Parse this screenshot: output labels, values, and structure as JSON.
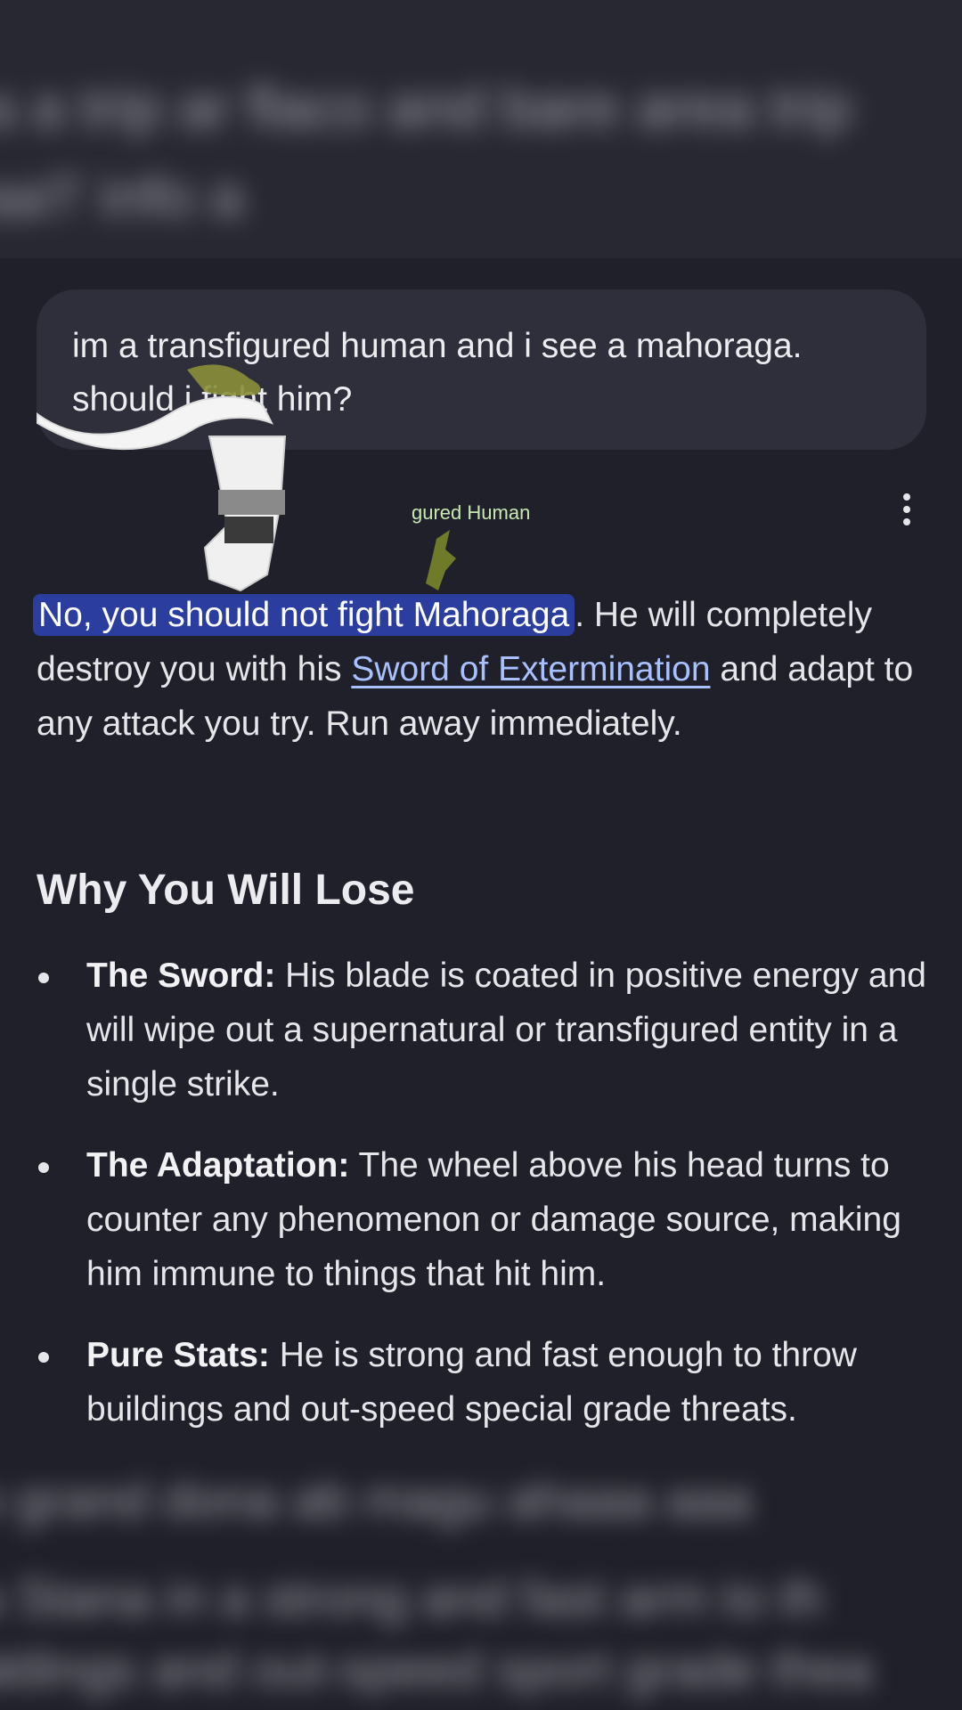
{
  "blurred_top": {
    "lines": [
      "a a trip ar flaco and bare area trip",
      "aa'l' info a"
    ]
  },
  "user_message": {
    "text": "im a transfigured human and i see a mahoraga. should i fight him?"
  },
  "sticker": {
    "caption": "gured Human"
  },
  "response": {
    "highlight": "No, you should not fight Mahoraga",
    "after_highlight": ". He will completely destroy you with his ",
    "link_text": "Sword of Extermination",
    "after_link": " and adapt to any attack you try. Run away immediately.",
    "heading": "Why You Will Lose",
    "bullets": [
      {
        "title": "The Sword:",
        "text": " His blade is coated in positive energy and will wipe out a supernatural or transfigured entity in a single strike."
      },
      {
        "title": "The Adaptation:",
        "text": " The wheel above his head turns to counter any phenomenon or damage source, making him immune to things that hit him."
      },
      {
        "title": "Pure Stats:",
        "text": " He is strong and fast enough to throw buildings and out-speed special grade threats."
      }
    ]
  },
  "blurred_bottom": {
    "lines": [
      "o grand dona ab magu ahaaa aaa",
      "a Stana in a strong and fast arm to th",
      "aldings and out-speed sport grade thea"
    ]
  },
  "colors": {
    "background": "#1f2029",
    "bubble": "#2e2f3a",
    "highlight": "#2b3d9e",
    "link": "#a8c0ff"
  }
}
